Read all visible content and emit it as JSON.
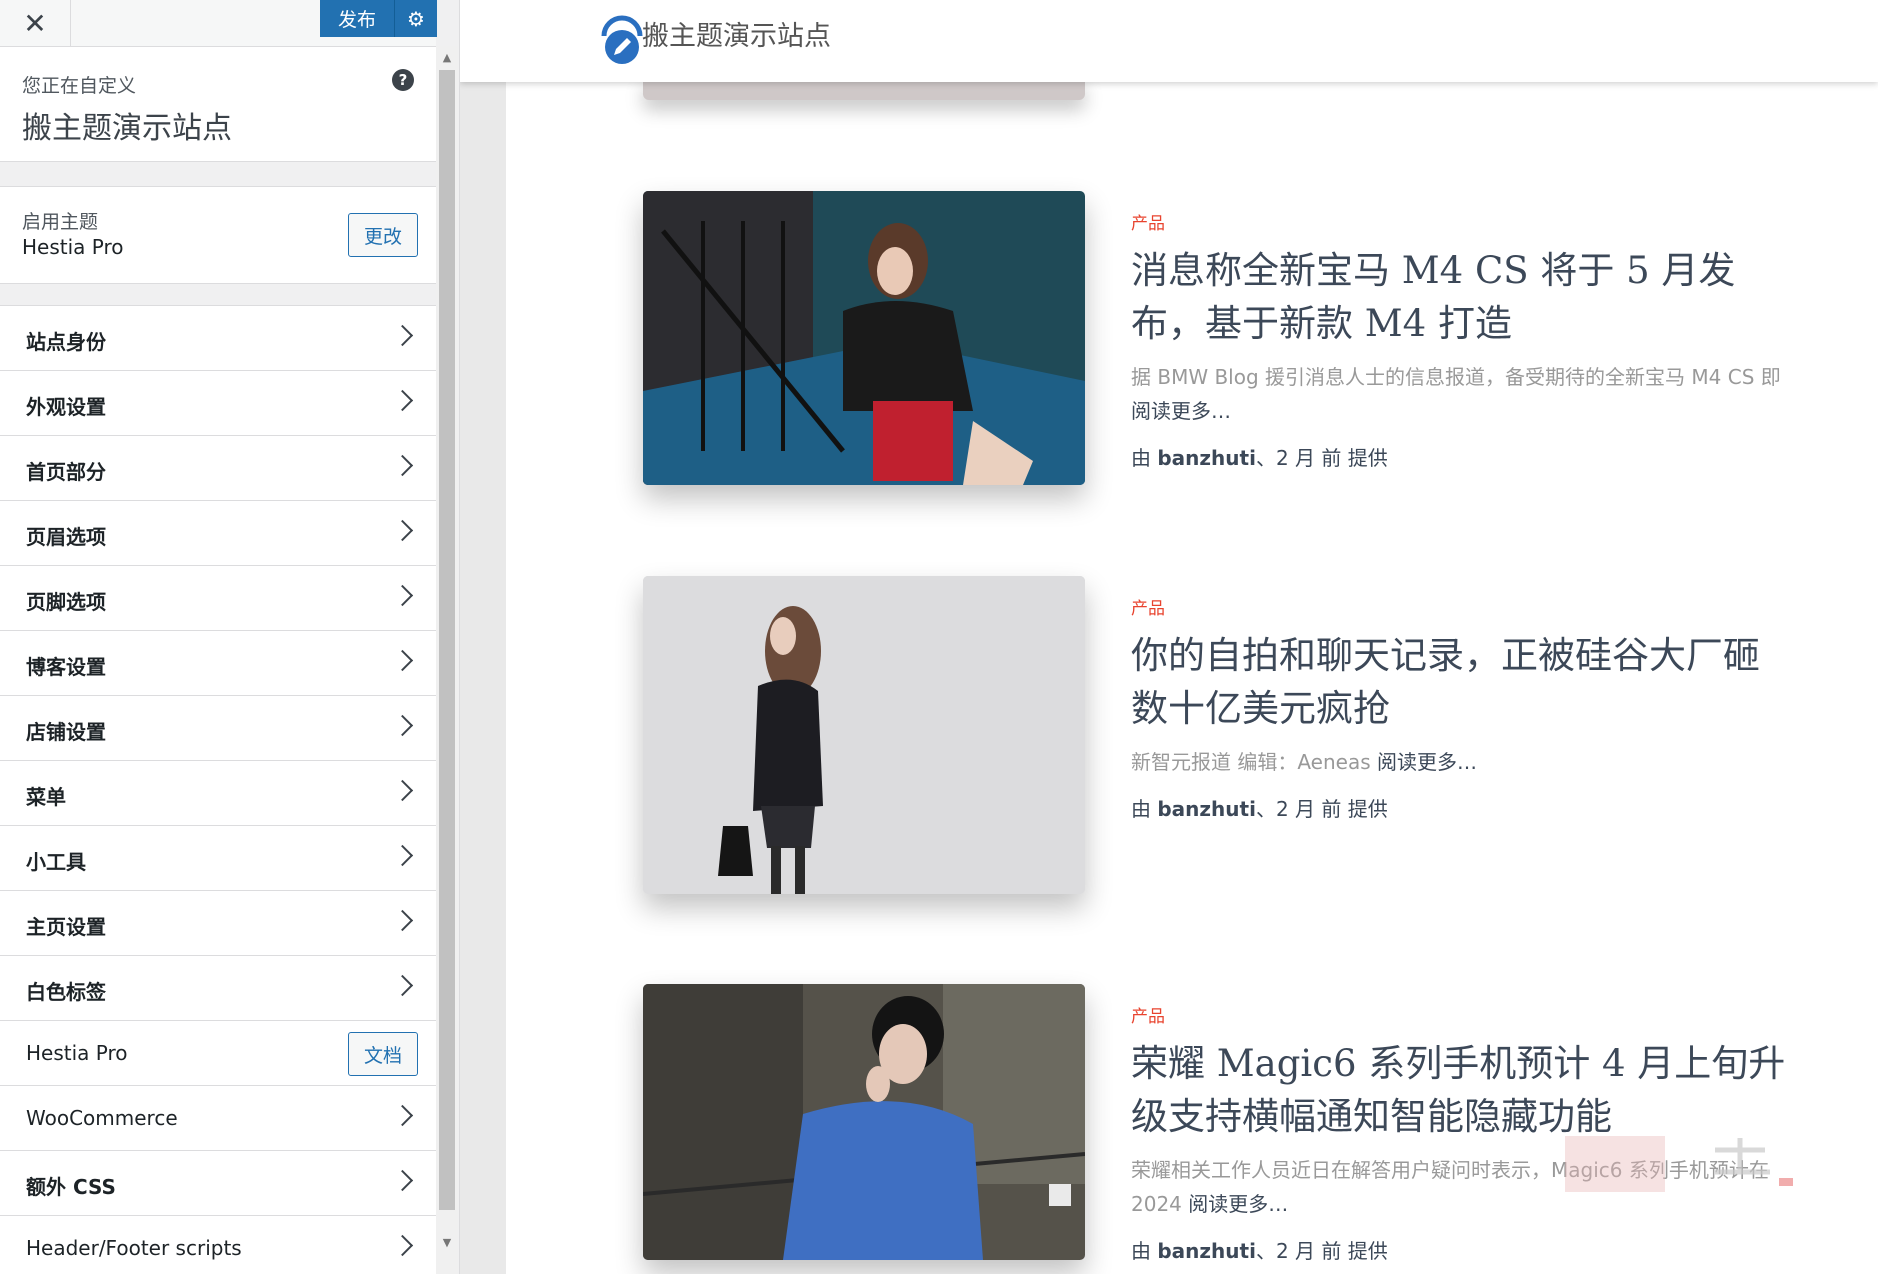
{
  "sidebar": {
    "close": "✕",
    "publish_label": "发布",
    "info": {
      "pre": "您正在自定义",
      "title": "搬主题演示站点"
    },
    "theme": {
      "label": "启用主题",
      "name": "Hestia Pro",
      "change_label": "更改"
    },
    "items": [
      {
        "label": "站点身份"
      },
      {
        "label": "外观设置"
      },
      {
        "label": "首页部分"
      },
      {
        "label": "页眉选项"
      },
      {
        "label": "页脚选项"
      },
      {
        "label": "博客设置"
      },
      {
        "label": "店铺设置"
      },
      {
        "label": "菜单"
      },
      {
        "label": "小工具"
      },
      {
        "label": "主页设置"
      },
      {
        "label": "白色标签"
      },
      {
        "label": "Hestia Pro",
        "button": "文档"
      },
      {
        "label": "WooCommerce"
      },
      {
        "label": "额外 CSS"
      },
      {
        "label": "Header/Footer scripts"
      }
    ]
  },
  "preview": {
    "site_title": "搬主题演示站点",
    "posts": [
      {
        "category": "产品",
        "title": "消息称全新宝马 M4 CS 将于 5 月发布，基于新款 M4 打造",
        "excerpt": "据 BMW Blog 援引消息人士的信息报道，备受期待的全新宝马 M4 CS 即",
        "read_more": "阅读更多…",
        "by_pre": "由 ",
        "author": "banzhuti",
        "by_post": "、2 月 前 提供"
      },
      {
        "category": "产品",
        "title": "你的自拍和聊天记录，正被硅谷大厂砸数十亿美元疯抢",
        "excerpt": " 新智元报道  编辑：Aeneas ",
        "read_more": "阅读更多…",
        "by_pre": "由 ",
        "author": "banzhuti",
        "by_post": "、2 月 前 提供"
      },
      {
        "category": "产品",
        "title": "荣耀 Magic6 系列手机预计 4 月上旬升级支持横幅通知智能隐藏功能",
        "excerpt": "荣耀相关工作人员近日在解答用户疑问时表示，Magic6 系列手机预计在 2024",
        "read_more": "阅读更多…",
        "by_pre": "由 ",
        "author": "banzhuti",
        "by_post": "、2 月 前 提供"
      }
    ]
  },
  "colors": {
    "accent": "#2271b1",
    "category": "#e8432e",
    "title": "#3c4858"
  }
}
